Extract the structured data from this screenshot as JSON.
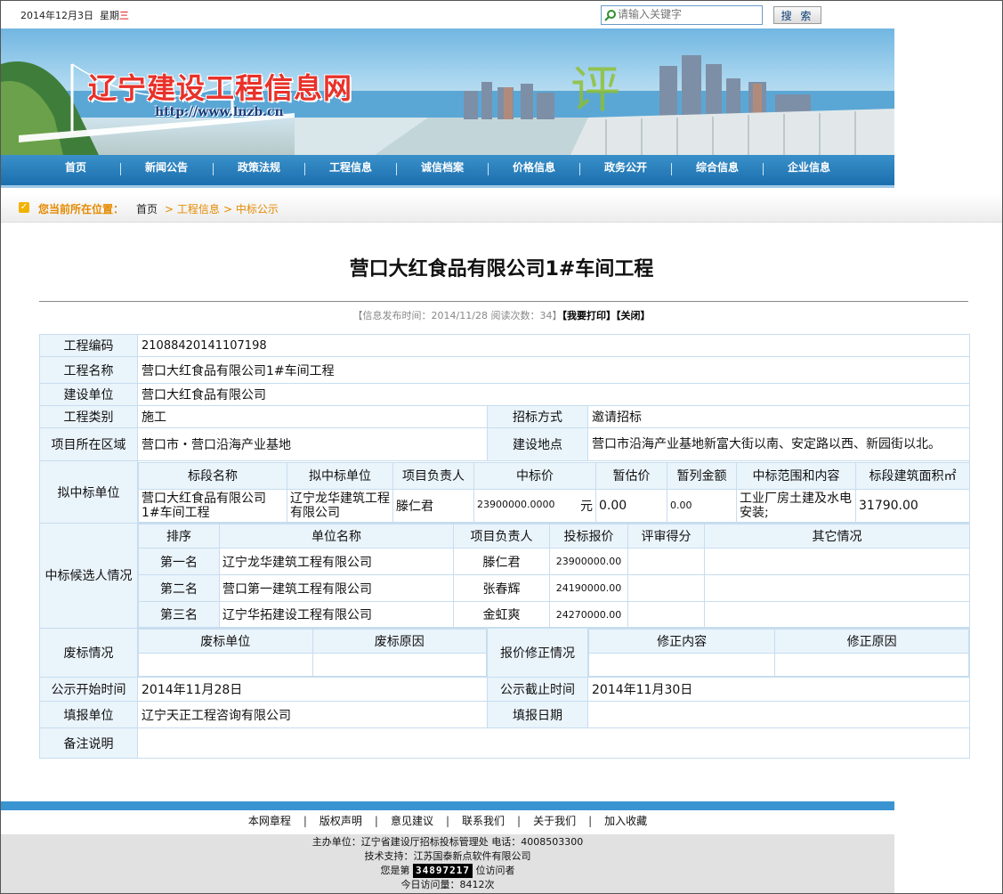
{
  "topbar": {
    "date": "2014年12月3日",
    "weekday_prefix": "星期",
    "weekday_day": "三",
    "search_placeholder": "请输入关键字",
    "search_button": "搜 索"
  },
  "banner": {
    "site_name": "辽宁建设工程信息网",
    "url": "http://www.lnzb.cn"
  },
  "nav": {
    "items": [
      "首页",
      "新闻公告",
      "政策法规",
      "工程信息",
      "诚信档案",
      "价格信息",
      "政务公开",
      "综合信息",
      "企业信息"
    ]
  },
  "location": {
    "label": "您当前所在位置：",
    "home": "首页",
    "crumb1": "> 工程信息",
    "crumb2": "> 中标公示"
  },
  "article": {
    "title": "营口大红食品有限公司1#车间工程",
    "meta_info": "【信息发布时间：2014/11/28 阅读次数：34】",
    "print_link": "【我要打印】",
    "close_link": "【关闭】"
  },
  "detail": {
    "labels": {
      "project_code": "工程编码",
      "project_name": "工程名称",
      "build_unit": "建设单位",
      "project_type": "工程类别",
      "bid_method": "招标方式",
      "region": "项目所在区域",
      "location": "建设地点",
      "proposed_winner": "拟中标单位",
      "candidates": "中标候选人情况",
      "invalid": "废标情况",
      "price_correction": "报价修正情况",
      "publicity_start": "公示开始时间",
      "publicity_end": "公示截止时间",
      "filler_unit": "填报单位",
      "filler_date": "填报日期",
      "remarks": "备注说明"
    },
    "values": {
      "project_code": "21088420141107198",
      "project_name": "营口大红食品有限公司1#车间工程",
      "build_unit": "营口大红食品有限公司",
      "project_type": "施工",
      "bid_method": "邀请招标",
      "region": "营口市・营口沿海产业基地",
      "location": "营口市沿海产业基地新富大街以南、安定路以西、新园街以北。",
      "publicity_start": "2014年11月28日",
      "publicity_end": "2014年11月30日",
      "filler_unit": "辽宁天正工程咨询有限公司",
      "filler_date": "",
      "remarks": ""
    },
    "winner_headers": [
      "标段名称",
      "拟中标单位",
      "项目负责人",
      "中标价",
      "暂估价",
      "暂列金额",
      "中标范围和内容",
      "标段建筑面积㎡"
    ],
    "winner_row": {
      "section": "营口大红食品有限公司1#车间工程",
      "unit": "辽宁龙华建筑工程有限公司",
      "manager": "滕仁君",
      "price": "23900000.0000",
      "price_unit": "元",
      "provisional": "0.00",
      "provisional_sum": "0.00",
      "scope": "工业厂房土建及水电安装;",
      "area": "31790.00"
    },
    "candidate_headers": [
      "排序",
      "单位名称",
      "项目负责人",
      "投标报价",
      "评审得分",
      "其它情况"
    ],
    "candidate_rows": [
      {
        "rank": "第一名",
        "unit": "辽宁龙华建筑工程有限公司",
        "manager": "滕仁君",
        "bid": "23900000.00",
        "score": "",
        "other": ""
      },
      {
        "rank": "第二名",
        "unit": "营口第一建筑工程有限公司",
        "manager": "张春辉",
        "bid": "24190000.00",
        "score": "",
        "other": ""
      },
      {
        "rank": "第三名",
        "unit": "辽宁华拓建设工程有限公司",
        "manager": "金虹爽",
        "bid": "24270000.00",
        "score": "",
        "other": ""
      }
    ],
    "invalid_headers": [
      "废标单位",
      "废标原因"
    ],
    "correction_headers": [
      "修正内容",
      "修正原因"
    ]
  },
  "footer": {
    "links": [
      "本网章程",
      "版权声明",
      "意见建议",
      "联系我们",
      "关于我们",
      "加入收藏"
    ],
    "host": "主办单位：辽宁省建设厅招标投标管理处 电话：4008503300",
    "tech": "技术支持：江苏国泰新点软件有限公司",
    "visitor_prefix": "您是第",
    "visitor_count": "34897217",
    "visitor_suffix": "位访问者",
    "today": "今日访问量：8412次"
  }
}
